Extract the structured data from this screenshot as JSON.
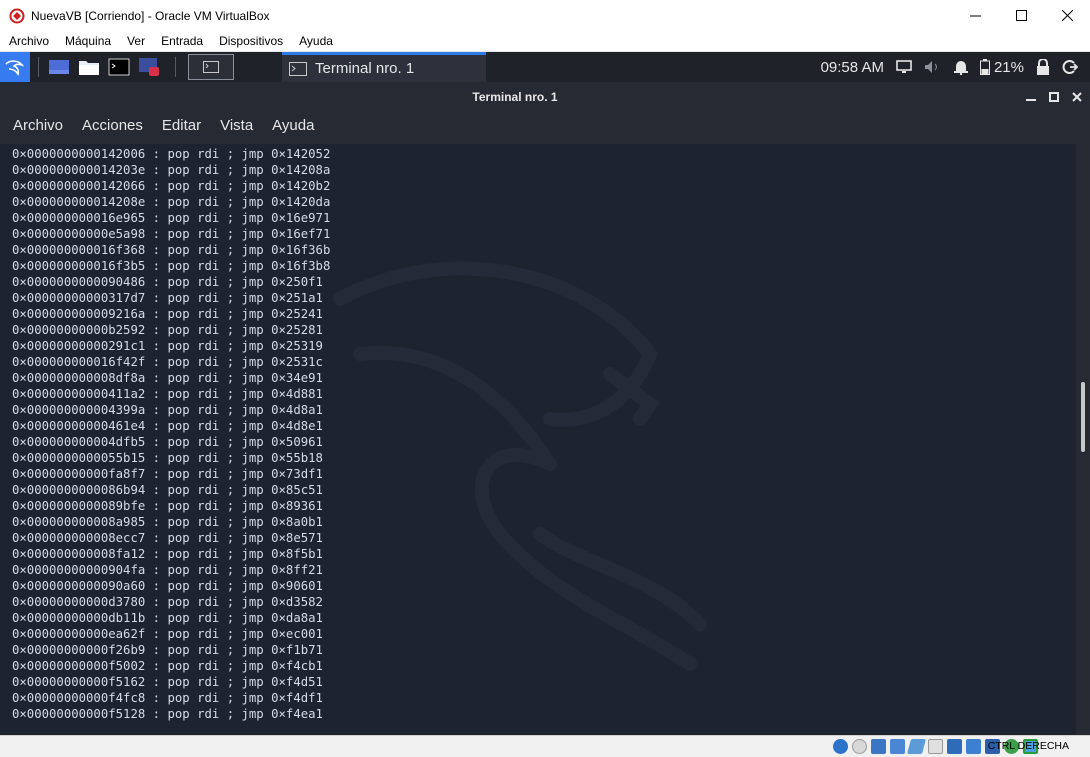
{
  "window": {
    "title": "NuevaVB [Corriendo] - Oracle VM VirtualBox"
  },
  "host_menu": [
    "Archivo",
    "Máquina",
    "Ver",
    "Entrada",
    "Dispositivos",
    "Ayuda"
  ],
  "guest_panel": {
    "taskbar_item": "Terminal nro. 1",
    "clock": "09:58 AM",
    "battery_percent": "21%"
  },
  "terminal": {
    "title": "Terminal nro. 1",
    "menu": [
      "Archivo",
      "Acciones",
      "Editar",
      "Vista",
      "Ayuda"
    ],
    "lines": [
      "0×0000000000142006 : pop rdi ; jmp 0×142052",
      "0×000000000014203e : pop rdi ; jmp 0×14208a",
      "0×0000000000142066 : pop rdi ; jmp 0×1420b2",
      "0×000000000014208e : pop rdi ; jmp 0×1420da",
      "0×000000000016e965 : pop rdi ; jmp 0×16e971",
      "0×00000000000e5a98 : pop rdi ; jmp 0×16ef71",
      "0×000000000016f368 : pop rdi ; jmp 0×16f36b",
      "0×000000000016f3b5 : pop rdi ; jmp 0×16f3b8",
      "0×0000000000090486 : pop rdi ; jmp 0×250f1",
      "0×00000000000317d7 : pop rdi ; jmp 0×251a1",
      "0×000000000009216a : pop rdi ; jmp 0×25241",
      "0×00000000000b2592 : pop rdi ; jmp 0×25281",
      "0×00000000000291c1 : pop rdi ; jmp 0×25319",
      "0×000000000016f42f : pop rdi ; jmp 0×2531c",
      "0×000000000008df8a : pop rdi ; jmp 0×34e91",
      "0×00000000000411a2 : pop rdi ; jmp 0×4d881",
      "0×000000000004399a : pop rdi ; jmp 0×4d8a1",
      "0×00000000000461e4 : pop rdi ; jmp 0×4d8e1",
      "0×000000000004dfb5 : pop rdi ; jmp 0×50961",
      "0×0000000000055b15 : pop rdi ; jmp 0×55b18",
      "0×00000000000fa8f7 : pop rdi ; jmp 0×73df1",
      "0×0000000000086b94 : pop rdi ; jmp 0×85c51",
      "0×0000000000089bfe : pop rdi ; jmp 0×89361",
      "0×000000000008a985 : pop rdi ; jmp 0×8a0b1",
      "0×000000000008ecc7 : pop rdi ; jmp 0×8e571",
      "0×000000000008fa12 : pop rdi ; jmp 0×8f5b1",
      "0×00000000000904fa : pop rdi ; jmp 0×8ff21",
      "0×0000000000090a60 : pop rdi ; jmp 0×90601",
      "0×00000000000d3780 : pop rdi ; jmp 0×d3582",
      "0×00000000000db11b : pop rdi ; jmp 0×da8a1",
      "0×00000000000ea62f : pop rdi ; jmp 0×ec001",
      "0×00000000000f26b9 : pop rdi ; jmp 0×f1b71",
      "0×00000000000f5002 : pop rdi ; jmp 0×f4cb1",
      "0×00000000000f5162 : pop rdi ; jmp 0×f4d51",
      "0×00000000000f4fc8 : pop rdi ; jmp 0×f4df1",
      "0×00000000000f5128 : pop rdi ; jmp 0×f4ea1"
    ]
  },
  "statusbar": {
    "host_key": "CTRL DERECHA"
  },
  "colors": {
    "terminal_bg": "#1e2330",
    "panel_bg": "#1f2229",
    "kali_blue": "#367bf0",
    "accent_blue": "#2e7de9"
  }
}
